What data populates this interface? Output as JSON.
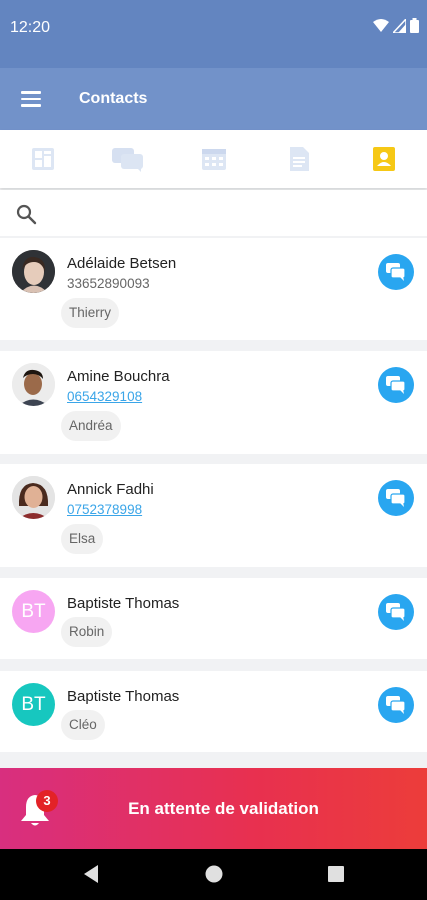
{
  "status": {
    "time": "12:20",
    "icons": [
      "wifi-icon",
      "signal-icon",
      "battery-icon"
    ]
  },
  "app_bar": {
    "title": "Contacts",
    "menu_icon": "menu-icon"
  },
  "tabs": [
    {
      "icon": "dashboard-icon",
      "active": false
    },
    {
      "icon": "chat-bubbles-icon",
      "active": false
    },
    {
      "icon": "calendar-icon",
      "active": false
    },
    {
      "icon": "document-icon",
      "active": false
    },
    {
      "icon": "contact-card-icon",
      "active": true
    }
  ],
  "search": {
    "icon": "search-icon"
  },
  "contacts": [
    {
      "name": "Adélaide Betsen",
      "phone": "33652890093",
      "phone_linked": false,
      "tag": "Thierry",
      "avatar": "photo"
    },
    {
      "name": "Amine Bouchra",
      "phone": "0654329108",
      "phone_linked": true,
      "tag": "Andréa",
      "avatar": "photo"
    },
    {
      "name": "Annick Fadhi",
      "phone": "0752378998",
      "phone_linked": true,
      "tag": "Elsa",
      "avatar": "photo"
    },
    {
      "name": "Baptiste Thomas",
      "phone": "",
      "tag": "Robin",
      "initials": "BT",
      "avatar_color": "#f7a6f2"
    },
    {
      "name": "Baptiste Thomas",
      "phone": "",
      "tag": "Cléo",
      "initials": "BT",
      "avatar_color": "#17c7bf"
    }
  ],
  "pending": {
    "count": "3",
    "label": "En attente de validation"
  },
  "colors": {
    "status_bar": "#6385c0",
    "app_bar": "#7292c9",
    "accent": "#29a6f0",
    "active_tab": "#f6c815",
    "pending_start": "#d82f7f",
    "pending_end": "#ec3d3a"
  }
}
